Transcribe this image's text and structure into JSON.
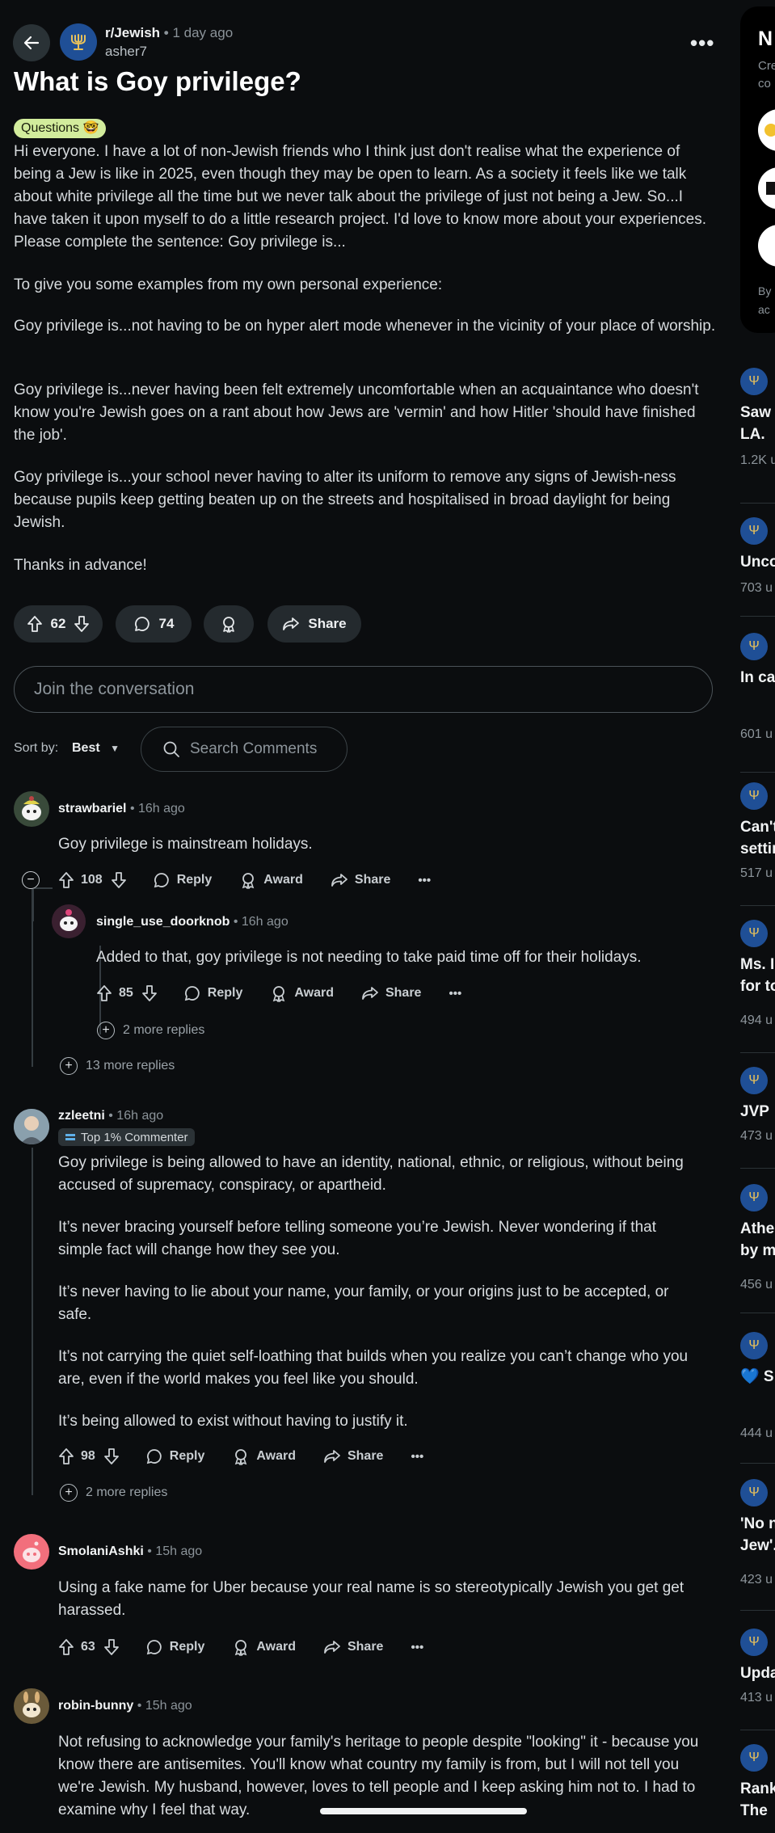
{
  "post": {
    "subreddit": "r/Jewish",
    "time": "1 day ago",
    "author": "asher7",
    "title": "What is Goy privilege?",
    "flair": "Questions 🤓",
    "body": [
      "Hi everyone. I have a lot of non-Jewish friends who I think just don't realise what the experience of being a Jew is like in 2025, even though they may be open to learn. As a society it feels like we talk about white privilege all the time but we never talk about the privilege of just not being a Jew. So...I have taken it upon myself to do a little research project. I'd love to know more about your experiences. Please complete the sentence: Goy privilege is...",
      "To give you some examples from my own personal experience:",
      "Goy privilege is...not having to be on hyper alert mode whenever in the vicinity of your place of worship.",
      "Goy privilege is...never having been felt extremely uncomfortable when an acquaintance who doesn't know you're Jewish goes on a rant about how Jews are 'vermin' and how Hitler 'should have finished the job'.",
      "Goy privilege is...your school never having to alter its uniform to remove any signs of Jewish-ness because pupils keep getting beaten up on the streets and hospitalised in broad daylight for being Jewish.",
      "Thanks in advance!"
    ],
    "votes": "62",
    "comments": "74",
    "share_label": "Share"
  },
  "composer": {
    "placeholder": "Join the conversation"
  },
  "sort": {
    "label": "Sort by:",
    "value": "Best",
    "search_placeholder": "Search Comments"
  },
  "comments": [
    {
      "user": "strawbariel",
      "time": "16h ago",
      "body": [
        "Goy privilege is mainstream holidays."
      ],
      "votes": "108",
      "reply": "Reply",
      "award": "Award",
      "share": "Share",
      "replies": [
        {
          "user": "single_use_doorknob",
          "time": "16h ago",
          "body": [
            "Added to that, goy privilege is not needing to take paid time off for their holidays."
          ],
          "votes": "85",
          "reply": "Reply",
          "award": "Award",
          "share": "Share",
          "more": "2 more replies"
        }
      ],
      "more": "13 more replies"
    },
    {
      "user": "zzleetni",
      "time": "16h ago",
      "badge": "Top 1% Commenter",
      "body": [
        "Goy privilege is being allowed to have an identity, national, ethnic, or religious, without being accused of supremacy, conspiracy, or apartheid.",
        "It’s never bracing yourself before telling someone you’re Jewish. Never wondering if that simple fact will change how they see you.",
        "It’s never having to lie about your name, your family, or your origins just to be accepted, or safe.",
        "It’s not carrying the quiet self-loathing that builds when you realize you can’t change who you are, even if the world makes you feel like you should.",
        "It’s being allowed to exist without having to justify it."
      ],
      "votes": "98",
      "reply": "Reply",
      "award": "Award",
      "share": "Share",
      "more": "2 more replies"
    },
    {
      "user": "SmolaniAshki",
      "time": "15h ago",
      "body": [
        "Using a fake name for Uber because your real name is so stereotypically Jewish you get get harassed."
      ],
      "votes": "63",
      "reply": "Reply",
      "award": "Award",
      "share": "Share"
    },
    {
      "user": "robin-bunny",
      "time": "15h ago",
      "body": [
        "Not refusing to acknowledge your family's heritage to people despite \"looking\" it - because you know there are antisemites. You'll know what country my family is from, but I will not tell you we're Jewish. My husband, however, loves to tell people and I keep asking him not to. I had to examine why I feel that way."
      ]
    }
  ],
  "sidebar": {
    "card": {
      "title": "N",
      "line1": "Cre",
      "line2": "co",
      "footer1": "By",
      "footer2": "ac"
    },
    "posts": [
      {
        "title": [
          "Saw",
          "LA."
        ],
        "meta": "1.2K u"
      },
      {
        "title": [
          "Unco"
        ],
        "meta": "703 u"
      },
      {
        "title": [
          "In ca"
        ],
        "meta": "601 u"
      },
      {
        "title": [
          "Can't",
          "settir"
        ],
        "meta": "517 u"
      },
      {
        "title": [
          "Ms. I",
          "for to"
        ],
        "meta": "494 u"
      },
      {
        "title": [
          "JVP"
        ],
        "meta": "473 u"
      },
      {
        "title": [
          "Athe",
          "by m"
        ],
        "meta": "456 u"
      },
      {
        "title": [
          "💙 S"
        ],
        "meta": "444 u"
      },
      {
        "title": [
          "'No n",
          "Jew'."
        ],
        "meta": "423 u"
      },
      {
        "title": [
          "Upda"
        ],
        "meta": "413 u"
      },
      {
        "title": [
          "Rank",
          "The"
        ],
        "meta": ""
      }
    ]
  },
  "colors": {
    "background": "#0b0d0f",
    "pill": "#242a2e",
    "flair": "#d2ec9c",
    "subreddit_avatar": "#1f4f96"
  }
}
